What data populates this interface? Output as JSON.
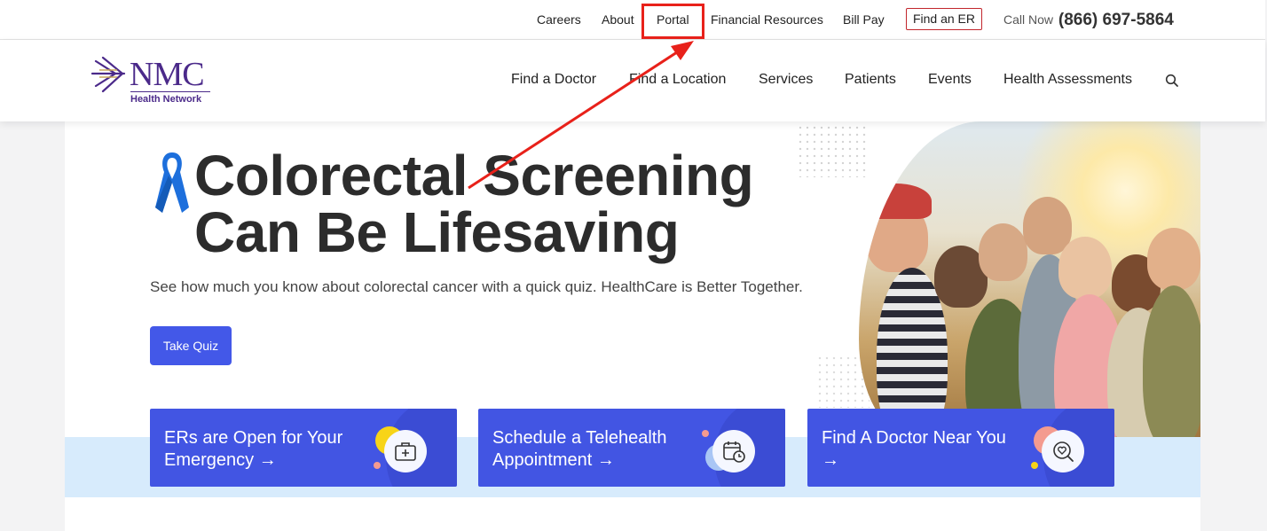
{
  "utility_nav": {
    "careers": "Careers",
    "about": "About",
    "portal": "Portal",
    "financial": "Financial Resources",
    "billpay": "Bill Pay",
    "find_er": "Find an ER",
    "call_label": "Call Now",
    "phone": "(866) 697-5864"
  },
  "logo": {
    "name": "NMC",
    "subtitle": "Health Network"
  },
  "main_nav": {
    "find_doctor": "Find a Doctor",
    "find_location": "Find a Location",
    "services": "Services",
    "patients": "Patients",
    "events": "Events",
    "health_assessments": "Health Assessments"
  },
  "hero": {
    "title_line1": "Colorectal Screening",
    "title_line2": "Can Be Lifesaving",
    "subtitle": "See how much you know about colorectal cancer with a quick quiz. HealthCare is Better Together.",
    "cta": "Take Quiz"
  },
  "cards": {
    "er": {
      "line1": "ERs are Open for Your",
      "line2": "Emergency →",
      "icon": "first-aid-kit-icon"
    },
    "telehealth": {
      "line1": "Schedule a Telehealth",
      "line2": "Appointment →",
      "icon": "calendar-clock-icon"
    },
    "doctor": {
      "line1": "Find A Doctor Near You",
      "line2": "→",
      "icon": "heart-search-icon"
    }
  },
  "colors": {
    "brand_purple": "#4b2a8a",
    "accent_blue": "#4358e8",
    "annotation_red": "#e8211a",
    "er_border": "#c2262c"
  }
}
